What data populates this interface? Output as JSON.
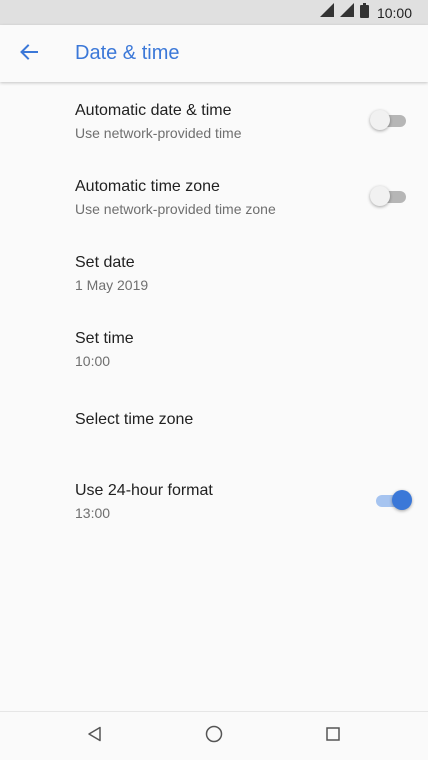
{
  "status_bar": {
    "time": "10:00",
    "icons": [
      "signal-icon",
      "signal-icon",
      "battery-icon"
    ]
  },
  "app_bar": {
    "back_icon": "arrow-left-icon",
    "title": "Date & time"
  },
  "settings": {
    "items": [
      {
        "title": "Automatic date & time",
        "subtitle": "Use network-provided time",
        "switch": "off"
      },
      {
        "title": "Automatic time zone",
        "subtitle": "Use network-provided time zone",
        "switch": "off"
      },
      {
        "title": "Set date",
        "subtitle": "1 May 2019"
      },
      {
        "title": "Set time",
        "subtitle": "10:00"
      },
      {
        "title": "Select time zone"
      },
      {
        "title": "Use 24-hour format",
        "subtitle": "13:00",
        "switch": "on"
      }
    ]
  },
  "nav_bar": {
    "icons": [
      "back-triangle-icon",
      "home-circle-icon",
      "recents-square-icon"
    ]
  },
  "colors": {
    "accent": "#3b78d8",
    "switch_track_on": "#a6c4f0",
    "switch_track_off": "#b6b6b6",
    "switch_thumb_off": "#f1f1f1"
  }
}
